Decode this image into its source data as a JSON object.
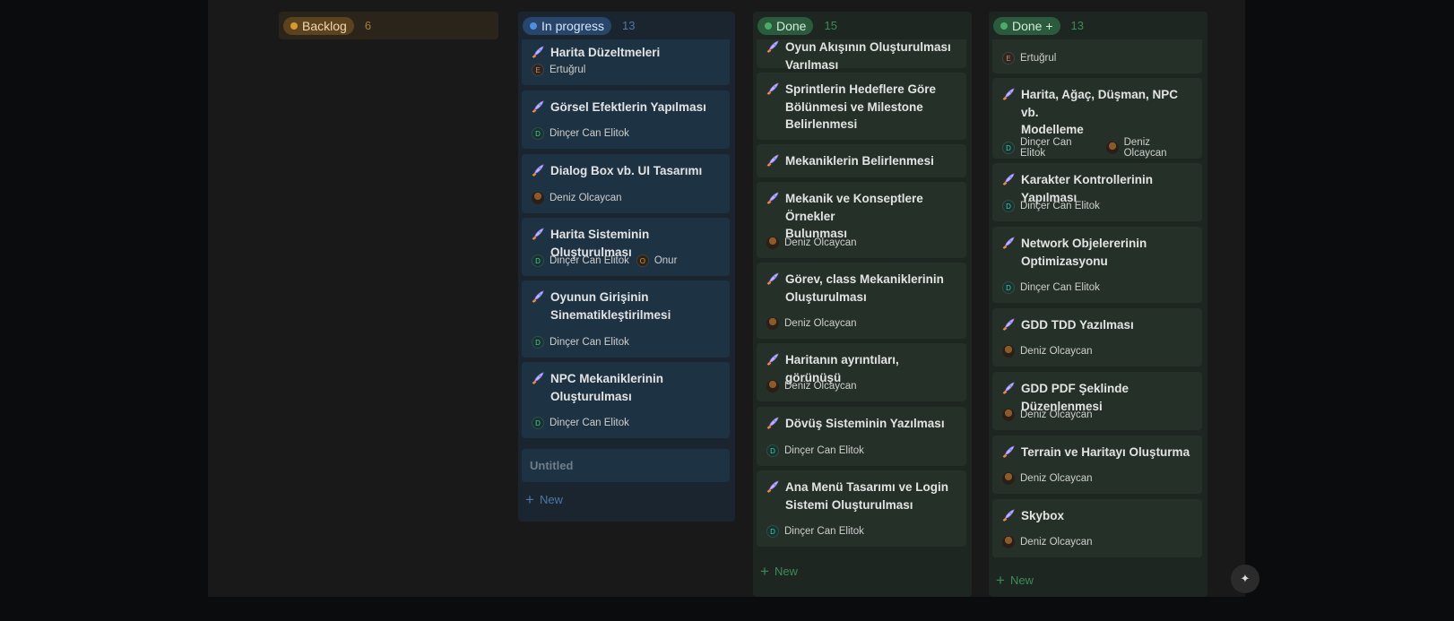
{
  "columns": [
    {
      "title": "Backlog",
      "count": "6",
      "headerBg": "#2a241b",
      "pillBg": "#5c4320",
      "pillText": "#f0d8ae",
      "dot": "#d79b2b",
      "countColor": "#a97d36",
      "bodyBg": "#191919",
      "cards": [],
      "footer": null
    },
    {
      "title": "In progress",
      "count": "13",
      "headerBg": "#1b2530",
      "pillBg": "#28456c",
      "pillText": "#d8e6f6",
      "dot": "#4e8ee0",
      "countColor": "#4d77a5",
      "bodyBg": "#1b2530",
      "cardBg": "#1d3242",
      "newColor": "#4d77a5",
      "cards": [
        {
          "title": [
            "Harita Düzeltmeleri"
          ],
          "people": [
            {
              "initial": "E",
              "name": "Ertuğrul",
              "style": "letter",
              "color": "#c48d6b",
              "bg": "#2c2522"
            }
          ]
        },
        {
          "title": [
            "Görsel Efektlerin Yapılması"
          ],
          "people": [
            {
              "initial": "D",
              "name": "Dinçer Can Elitok",
              "style": "letter",
              "color": "#4fc7a5",
              "bg": "#17332f"
            }
          ]
        },
        {
          "title": [
            "Dialog Box vb. UI Tasarımı"
          ],
          "people": [
            {
              "initial": "",
              "name": "Deniz Olcaycan",
              "style": "photo"
            }
          ]
        },
        {
          "title": [
            "Harita Sisteminin Oluşturulması"
          ],
          "people": [
            {
              "initial": "D",
              "name": "Dinçer Can Elitok",
              "style": "letter",
              "color": "#4fc7a5",
              "bg": "#17332f"
            },
            {
              "initial": "O",
              "name": "Onur",
              "style": "letter",
              "color": "#d69a4e",
              "bg": "#2c2418"
            }
          ]
        },
        {
          "title": [
            "Oyunun Girişinin",
            "Sinematikleştirilmesi"
          ],
          "people": [
            {
              "initial": "D",
              "name": "Dinçer Can Elitok",
              "style": "letter",
              "color": "#4fc7a5",
              "bg": "#17332f"
            }
          ]
        },
        {
          "title": [
            "NPC Mekaniklerinin",
            "Oluşturulması"
          ],
          "people": [
            {
              "initial": "D",
              "name": "Dinçer Can Elitok",
              "style": "letter",
              "color": "#4fc7a5",
              "bg": "#17332f"
            }
          ]
        }
      ],
      "untitled": "Untitled",
      "footer": "New"
    },
    {
      "title": "Done",
      "count": "15",
      "headerBg": "#1e2621",
      "pillBg": "#2b5a3c",
      "pillText": "#d5ecdc",
      "dot": "#4cab6a",
      "countColor": "#3f8a58",
      "bodyBg": "#1e2621",
      "cardBg": "#253029",
      "newColor": "#3f8a58",
      "cards": [
        {
          "title": [
            "Oyun Akışının Oluşturulması",
            "Varılması"
          ],
          "people": []
        },
        {
          "title": [
            "Sprintlerin Hedeflere Göre",
            "Bölünmesi ve Milestone",
            "Belirlenmesi"
          ],
          "people": []
        },
        {
          "title": [
            "Mekaniklerin Belirlenmesi"
          ],
          "people": []
        },
        {
          "title": [
            "Mekanik ve Konseptlere Örnekler",
            "Bulunması"
          ],
          "people": [
            {
              "initial": "",
              "name": "Deniz Olcaycan",
              "style": "photo"
            }
          ]
        },
        {
          "title": [
            "Görev, class Mekaniklerinin",
            "Oluşturulması"
          ],
          "people": [
            {
              "initial": "",
              "name": "Deniz Olcaycan",
              "style": "photo"
            }
          ]
        },
        {
          "title": [
            "Haritanın ayrıntıları, görünüşü"
          ],
          "people": [
            {
              "initial": "",
              "name": "Deniz Olcaycan",
              "style": "photo"
            }
          ]
        },
        {
          "title": [
            "Dövüş Sisteminin Yazılması"
          ],
          "people": [
            {
              "initial": "D",
              "name": "Dinçer Can Elitok",
              "style": "letter",
              "color": "#4fc7a5",
              "bg": "#17332f"
            }
          ]
        },
        {
          "title": [
            "Ana Menü Tasarımı ve Login",
            "Sistemi Oluşturulması"
          ],
          "people": [
            {
              "initial": "D",
              "name": "Dinçer Can Elitok",
              "style": "letter",
              "color": "#4fc7a5",
              "bg": "#17332f"
            }
          ]
        }
      ],
      "footer": "New"
    },
    {
      "title": "Done +",
      "count": "13",
      "headerBg": "#1e2621",
      "pillBg": "#2b5a3c",
      "pillText": "#d5ecdc",
      "dot": "#4cab6a",
      "countColor": "#3f8a58",
      "bodyBg": "#1e2621",
      "cardBg": "#253029",
      "newColor": "#3f8a58",
      "cards": [
        {
          "title": [],
          "people": [
            {
              "initial": "E",
              "name": "Ertuğrul",
              "style": "letter",
              "color": "#c48d6b",
              "bg": "#2c2522"
            }
          ]
        },
        {
          "title": [
            "Harita, Ağaç, Düşman, NPC vb.",
            "Modelleme"
          ],
          "people": [
            {
              "initial": "D",
              "name": "Dinçer Can Elitok",
              "style": "letter",
              "color": "#4fc7a5",
              "bg": "#17332f"
            },
            {
              "initial": "",
              "name": "Deniz Olcaycan",
              "style": "photo"
            }
          ]
        },
        {
          "title": [
            "Karakter Kontrollerinin Yapılması"
          ],
          "people": [
            {
              "initial": "D",
              "name": "Dinçer Can Elitok",
              "style": "letter",
              "color": "#4fc7a5",
              "bg": "#17332f"
            }
          ]
        },
        {
          "title": [
            "Network Objelererinin",
            "Optimizasyonu"
          ],
          "people": [
            {
              "initial": "D",
              "name": "Dinçer Can Elitok",
              "style": "letter",
              "color": "#4fc7a5",
              "bg": "#17332f"
            }
          ]
        },
        {
          "title": [
            "GDD TDD Yazılması"
          ],
          "people": [
            {
              "initial": "",
              "name": "Deniz Olcaycan",
              "style": "photo"
            }
          ]
        },
        {
          "title": [
            "GDD PDF Şeklinde Düzenlenmesi"
          ],
          "people": [
            {
              "initial": "",
              "name": "Deniz Olcaycan",
              "style": "photo"
            }
          ]
        },
        {
          "title": [
            "Terrain ve Haritayı Oluşturma"
          ],
          "people": [
            {
              "initial": "",
              "name": "Deniz Olcaycan",
              "style": "photo"
            }
          ]
        },
        {
          "title": [
            "Skybox"
          ],
          "people": [
            {
              "initial": "",
              "name": "Deniz Olcaycan",
              "style": "photo"
            }
          ]
        }
      ],
      "footer": "New"
    }
  ],
  "fab_icon": "sparkle-icon"
}
